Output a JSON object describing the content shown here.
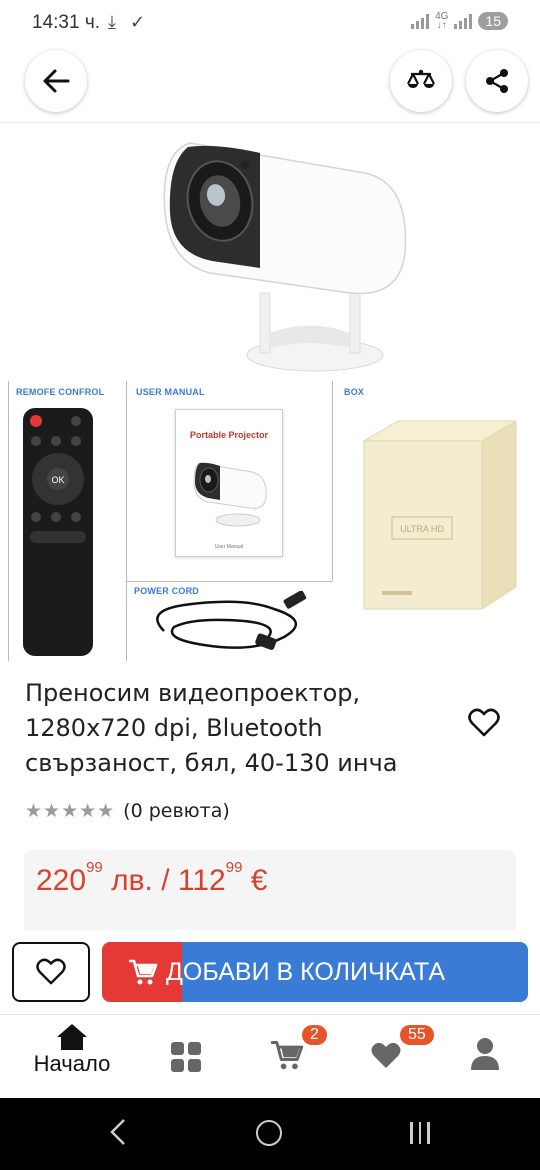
{
  "status_bar": {
    "time": "14:31 ч.",
    "network": "4G",
    "battery": "15"
  },
  "gallery": {
    "remote_label": "REMOFE CONFROL",
    "manual_label": "USER MANUAL",
    "box_label": "BOX",
    "cord_label": "POWER CORD",
    "manual_title": "Portable Projector",
    "manual_footer": "User Manual",
    "box_badge": "ULTRA HD"
  },
  "product": {
    "title_line1": "Преносим видеопроектор,",
    "title_line2": "1280x720 dpi, Bluetooth",
    "title_line3": "свързаност, бял, 40-130 инча",
    "reviews": "(0 ревюта)",
    "rating": 0,
    "price_bgn_int": "220",
    "price_bgn_dec": "99",
    "price_bgn_unit": "лв.",
    "price_sep": "/",
    "price_eur_int": "112",
    "price_eur_dec": "99",
    "price_eur_unit": "€"
  },
  "actions": {
    "add_to_cart": "ДОБАВИ В КОЛИЧКАТА"
  },
  "bottom_nav": {
    "home_label": "Начало",
    "cart_badge": "2",
    "fav_badge": "55"
  },
  "colors": {
    "accent_blue": "#3a7bd5",
    "accent_red": "#e53935",
    "price_red": "#d9412f",
    "badge_orange": "#e8542a"
  }
}
